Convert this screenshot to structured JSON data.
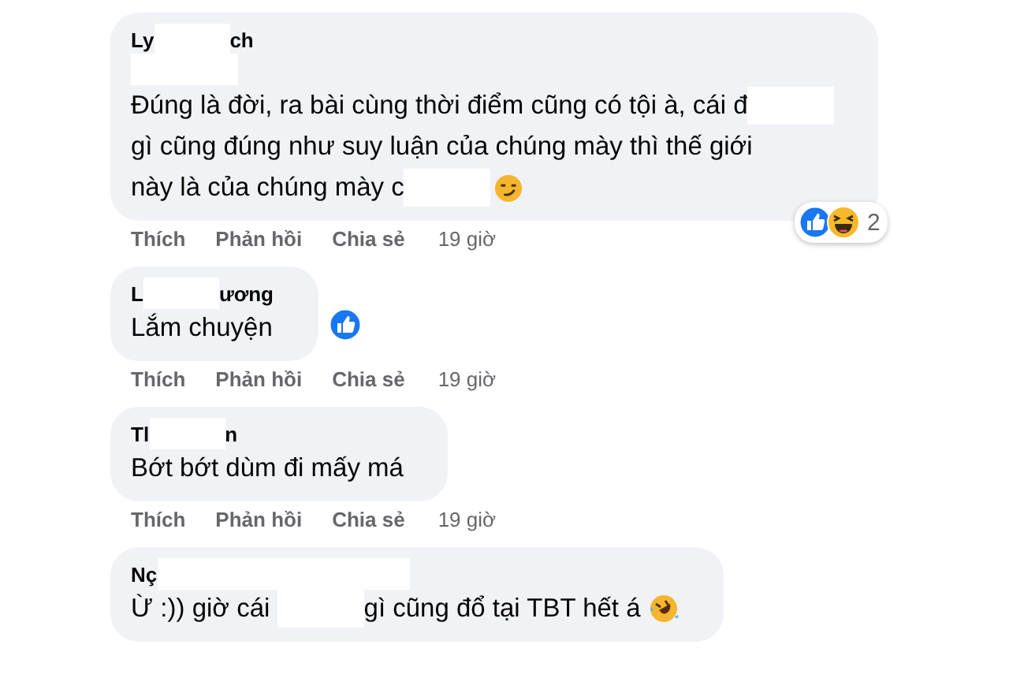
{
  "comments": [
    {
      "author": [
        {
          "kind": "text",
          "text": "Ly"
        },
        {
          "kind": "redacted"
        },
        {
          "kind": "text",
          "text": "ch"
        }
      ],
      "lines": [
        [
          {
            "kind": "redacted"
          }
        ],
        [
          {
            "kind": "text",
            "text": "Đúng là đời, ra bài cùng thời điểm cũng có tội à, cái đ"
          },
          {
            "kind": "redacted"
          }
        ],
        [
          {
            "kind": "text",
            "text": "gì cũng đúng như suy luận của chúng mày thì thế giới"
          }
        ],
        [
          {
            "kind": "text",
            "text": "này là của chúng mày c"
          },
          {
            "kind": "redacted"
          },
          {
            "kind": "smirk"
          }
        ]
      ],
      "badge": {
        "icons": [
          {
            "kind": "like"
          },
          {
            "kind": "haha"
          }
        ],
        "count": "2"
      },
      "actions": [
        "Thích",
        "Phản hồi",
        "Chia sẻ"
      ],
      "time": "19 giờ"
    },
    {
      "author": [
        {
          "kind": "text",
          "text": "L"
        },
        {
          "kind": "redacted"
        },
        {
          "kind": "text",
          "text": "ương"
        }
      ],
      "lines": [
        [
          {
            "kind": "text",
            "text": "Lắm chuyện"
          }
        ]
      ],
      "side_reaction": {
        "kind": "like"
      },
      "actions": [
        "Thích",
        "Phản hồi",
        "Chia sẻ"
      ],
      "time": "19 giờ"
    },
    {
      "author": [
        {
          "kind": "text",
          "text": "Tl"
        },
        {
          "kind": "redacted"
        },
        {
          "kind": "text",
          "text": "n"
        }
      ],
      "lines": [
        [
          {
            "kind": "text",
            "text": "Bớt bớt dùm đi mấy má"
          }
        ]
      ],
      "actions": [
        "Thích",
        "Phản hồi",
        "Chia sẻ"
      ],
      "time": "19 giờ"
    },
    {
      "author": [
        {
          "kind": "text",
          "text": "Nç"
        },
        {
          "kind": "redacted"
        }
      ],
      "lines": [
        [
          {
            "kind": "text",
            "text": "Ừ :)) giờ cái "
          },
          {
            "kind": "redacted"
          },
          {
            "kind": "text",
            "text": "gì cũng đổ tại TBT hết á"
          },
          {
            "kind": "rofl"
          }
        ]
      ]
    }
  ]
}
